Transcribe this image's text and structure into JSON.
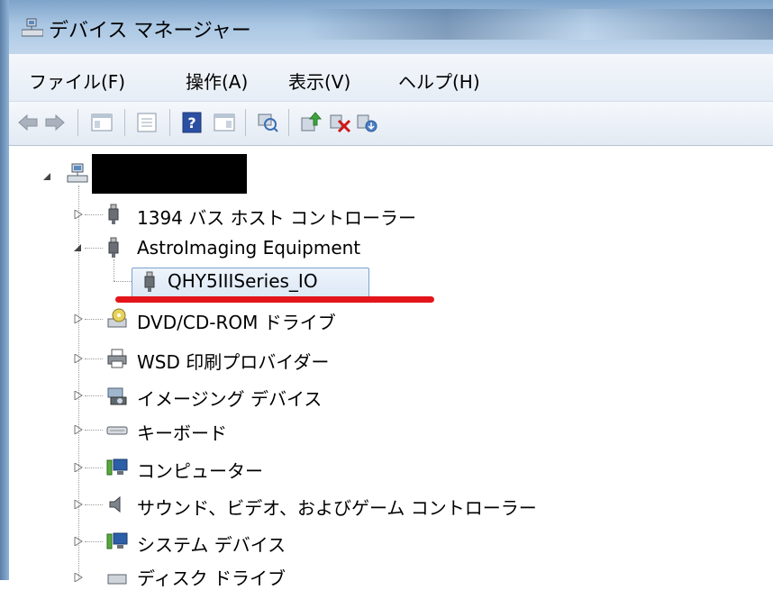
{
  "window": {
    "title": "デバイス マネージャー"
  },
  "menu": [
    "ファイル(F)",
    "操作(A)",
    "表示(V)",
    "ヘルプ(H)"
  ],
  "toolbar": {
    "icons": [
      "back-arrow-icon",
      "forward-arrow-icon",
      "show-hide-tree-icon",
      "properties-icon",
      "help-icon",
      "action-pane-icon",
      "scan-hardware-icon",
      "update-driver-icon",
      "uninstall-icon",
      "enable-device-icon"
    ]
  },
  "tree": {
    "items": [
      {
        "label": "1394 バス ホスト コントローラー",
        "icon": "usb-plug-icon",
        "expanded": false
      },
      {
        "label": "AstroImaging Equipment",
        "icon": "usb-plug-icon",
        "expanded": true
      },
      {
        "label": "QHY5IIISeries_IO",
        "icon": "usb-plug-icon",
        "selected": true
      },
      {
        "label": "DVD/CD-ROM ドライブ",
        "icon": "dvd-drive-icon",
        "expanded": false
      },
      {
        "label": "WSD 印刷プロバイダー",
        "icon": "printer-icon",
        "expanded": false
      },
      {
        "label": "イメージング デバイス",
        "icon": "camera-icon",
        "expanded": false
      },
      {
        "label": "キーボード",
        "icon": "keyboard-icon",
        "expanded": false
      },
      {
        "label": "コンピューター",
        "icon": "computer-icon",
        "expanded": false
      },
      {
        "label": "サウンド、ビデオ、およびゲーム コントローラー",
        "icon": "speaker-icon",
        "expanded": false
      },
      {
        "label": "システム デバイス",
        "icon": "computer-icon",
        "expanded": false
      },
      {
        "label": "ディスク ドライブ",
        "icon": "disk-drive-icon",
        "expanded": false
      }
    ]
  },
  "colors": {
    "highlight_underline": "#e3151a",
    "selection_border": "#7da2ce"
  }
}
